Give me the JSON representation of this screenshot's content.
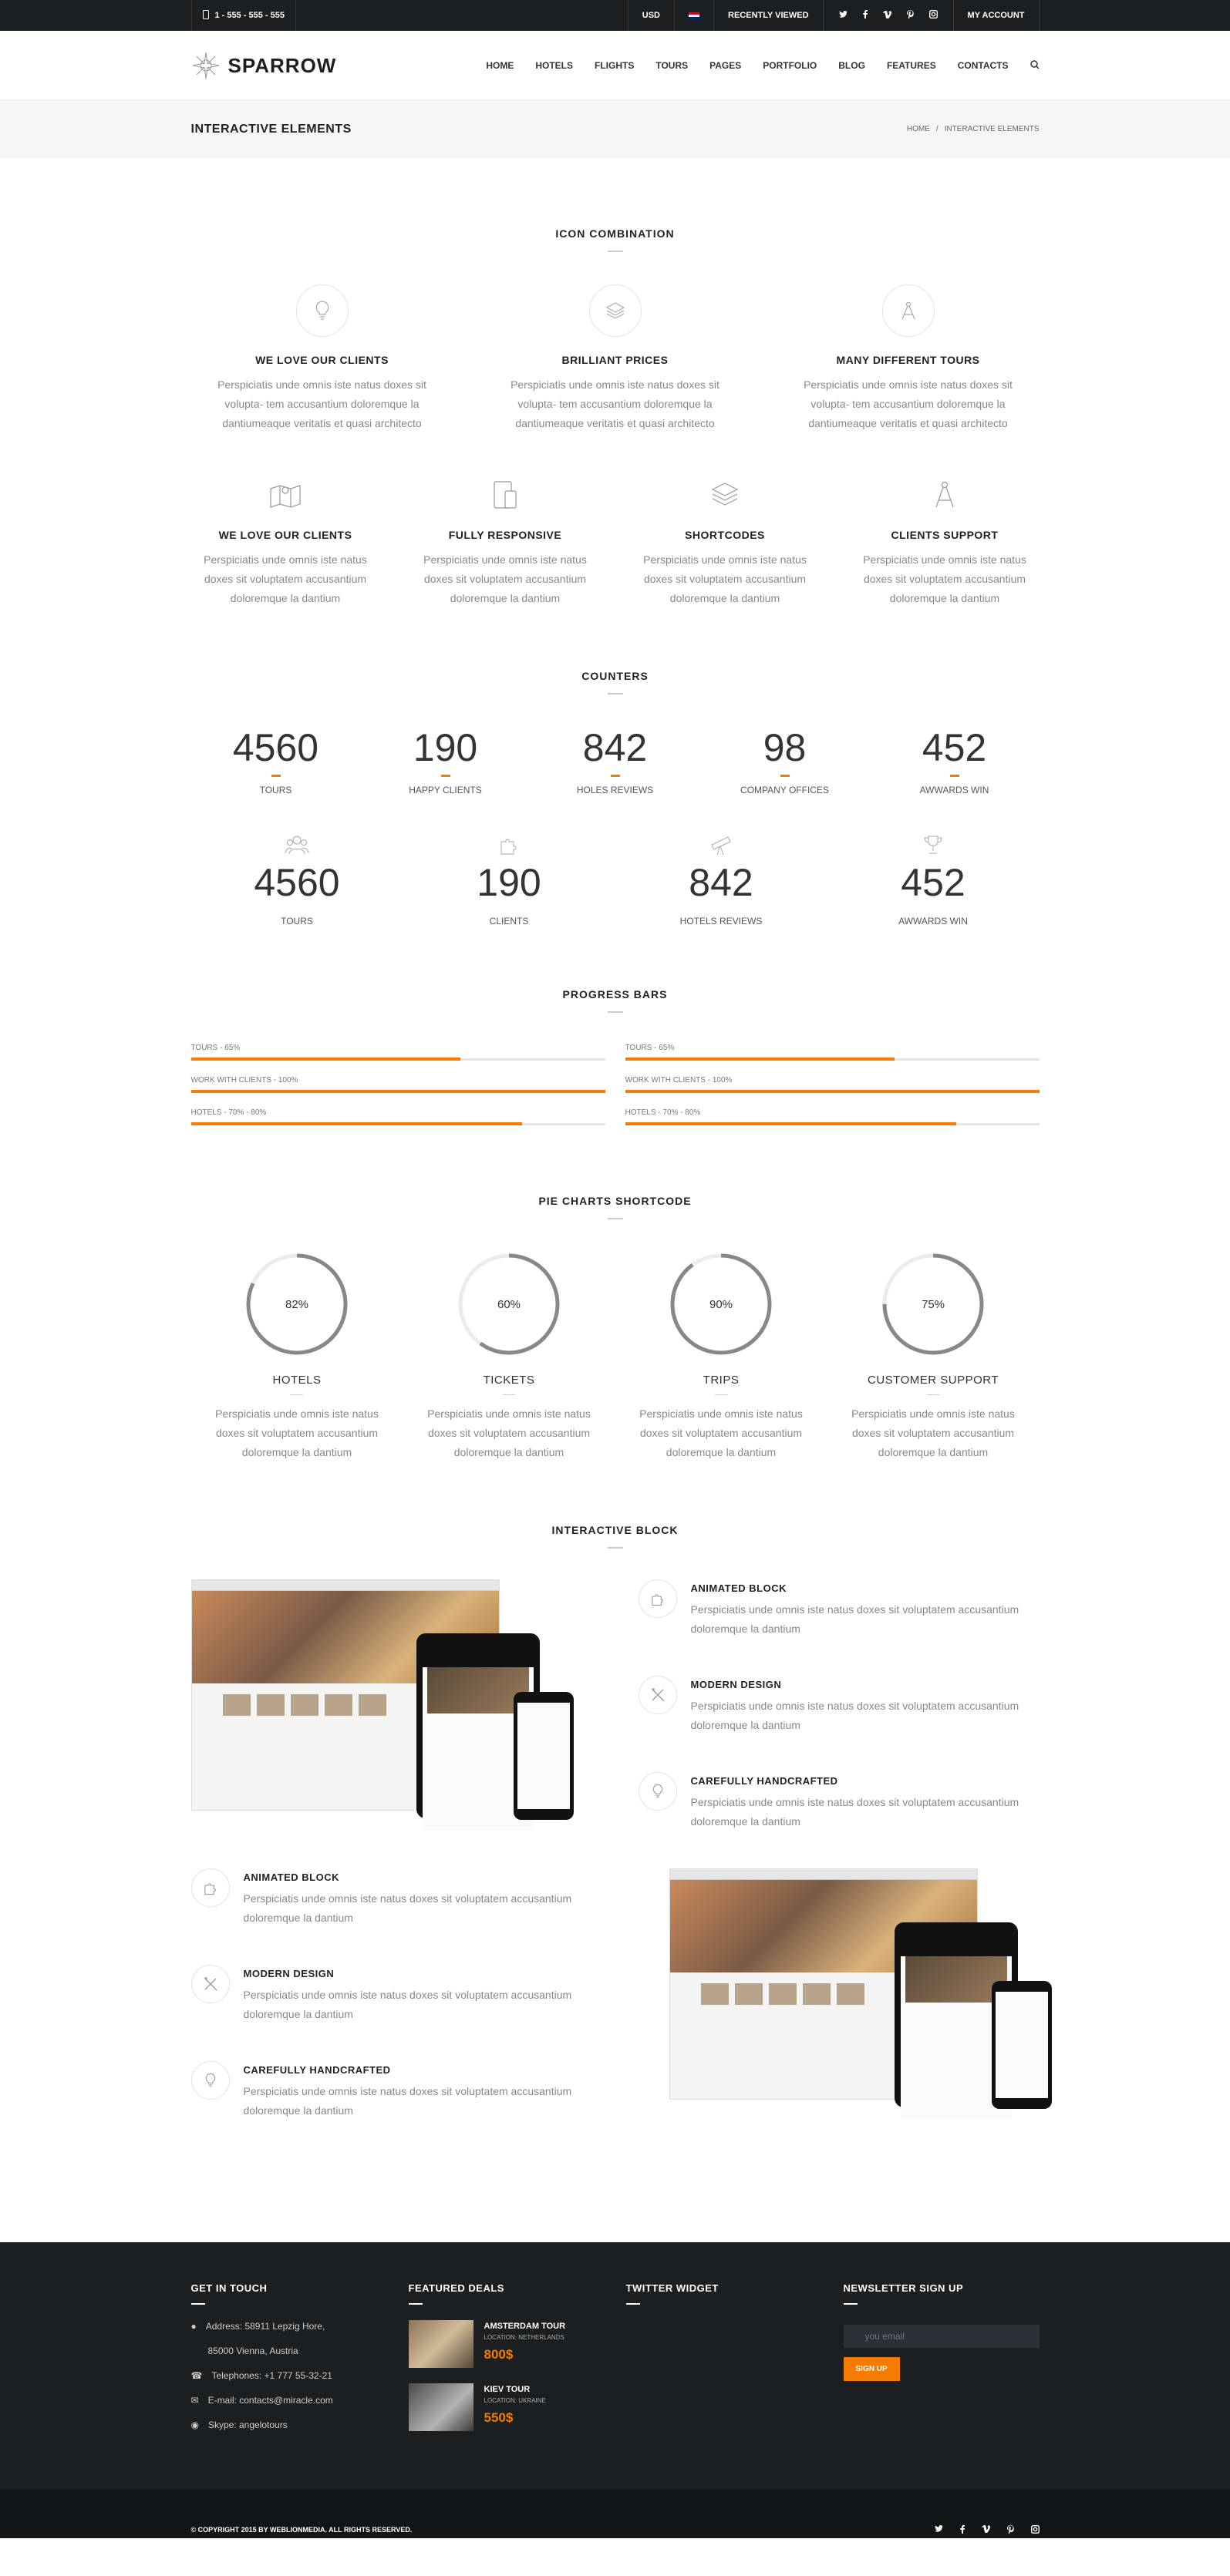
{
  "topbar": {
    "phone": "1 - 555 - 555 - 555",
    "currency": "USD",
    "recently_viewed": "RECENTLY VIEWED",
    "my_account": "MY ACCOUNT",
    "socials": [
      "twitter-icon",
      "facebook-icon",
      "vimeo-icon",
      "pinterest-icon",
      "instagram-icon"
    ]
  },
  "header": {
    "logo": "SPARROW",
    "nav": [
      "HOME",
      "HOTELS",
      "FLIGHTS",
      "TOURS",
      "PAGES",
      "PORTFOLIO",
      "BLOG",
      "FEATURES",
      "CONTACTS"
    ]
  },
  "page_title": {
    "title": "INTERACTIVE ELEMENTS",
    "crumb_home": "HOME",
    "crumb_sep": "/",
    "crumb_current": "INTERACTIVE ELEMENTS"
  },
  "icon_combination": {
    "title": "ICON COMBINATION",
    "row1": [
      {
        "icon": "lightbulb-icon",
        "title": "WE LOVE OUR CLIENTS",
        "text": "Perspiciatis unde omnis iste natus doxes sit volupta- tem accusantium doloremque la dantiumeaque veritatis et quasi architecto"
      },
      {
        "icon": "layers-icon",
        "title": "BRILLIANT PRICES",
        "text": "Perspiciatis unde omnis iste natus doxes sit volupta- tem accusantium doloremque la dantiumeaque veritatis et quasi architecto"
      },
      {
        "icon": "compass-icon",
        "title": "MANY DIFFERENT TOURS",
        "text": "Perspiciatis unde omnis iste natus doxes sit volupta- tem accusantium doloremque la dantiumeaque veritatis et quasi architecto"
      }
    ],
    "row2": [
      {
        "icon": "map-icon",
        "title": "WE LOVE OUR CLIENTS",
        "text": "Perspiciatis unde omnis iste natus doxes sit voluptatem accusantium doloremque la dantium"
      },
      {
        "icon": "devices-icon",
        "title": "FULLY RESPONSIVE",
        "text": "Perspiciatis unde omnis iste natus doxes sit voluptatem accusantium doloremque la dantium"
      },
      {
        "icon": "layers-icon",
        "title": "SHORTCODES",
        "text": "Perspiciatis unde omnis iste natus doxes sit voluptatem accusantium doloremque la dantium"
      },
      {
        "icon": "compass-icon",
        "title": "CLIENTS SUPPORT",
        "text": "Perspiciatis unde omnis iste natus doxes sit voluptatem accusantium doloremque la dantium"
      }
    ]
  },
  "counters": {
    "title": "COUNTERS",
    "row1": [
      {
        "value": "4560",
        "label": "TOURS"
      },
      {
        "value": "190",
        "label": "HAPPY CLIENTS"
      },
      {
        "value": "842",
        "label": "HOLES REVIEWS"
      },
      {
        "value": "98",
        "label": "COMPANY OFFICES"
      },
      {
        "value": "452",
        "label": "AWWARDS WIN"
      }
    ],
    "row2": [
      {
        "icon": "people-icon",
        "value": "4560",
        "label": "TOURS"
      },
      {
        "icon": "puzzle-icon",
        "value": "190",
        "label": "CLIENTS"
      },
      {
        "icon": "telescope-icon",
        "value": "842",
        "label": "HOTELS REVIEWS"
      },
      {
        "icon": "trophy-icon",
        "value": "452",
        "label": "AWWARDS WIN"
      }
    ]
  },
  "progress": {
    "title": "PROGRESS BARS",
    "left": [
      {
        "label": "TOURS - 65%",
        "value": 0.65
      },
      {
        "label": "WORK WITH CLIENTS - 100%",
        "value": 1.0
      },
      {
        "label": "HOTELS - 70% - 80%",
        "value": 0.8
      }
    ],
    "right": [
      {
        "label": "TOURS - 65%",
        "value": 0.65
      },
      {
        "label": "WORK WITH CLIENTS - 100%",
        "value": 1.0
      },
      {
        "label": "HOTELS - 70% - 80%",
        "value": 0.8
      }
    ],
    "accent": "#f57c00"
  },
  "pies": {
    "title": "PIE CHARTS SHORTCODE",
    "items": [
      {
        "pct": "82%",
        "value": 0.82,
        "title": "HOTELS",
        "text": "Perspiciatis unde omnis iste natus doxes sit voluptatem accusantium doloremque la dantium"
      },
      {
        "pct": "60%",
        "value": 0.6,
        "title": "TICKETS",
        "text": "Perspiciatis unde omnis iste natus doxes sit voluptatem accusantium doloremque la dantium"
      },
      {
        "pct": "90%",
        "value": 0.9,
        "title": "TRIPS",
        "text": "Perspiciatis unde omnis iste natus doxes sit voluptatem accusantium doloremque la dantium"
      },
      {
        "pct": "75%",
        "value": 0.75,
        "title": "CUSTOMER SUPPORT",
        "text": "Perspiciatis unde omnis iste natus doxes sit voluptatem accusantium doloremque la dantium"
      }
    ]
  },
  "interactive": {
    "title": "INTERACTIVE BLOCK",
    "items": [
      {
        "icon": "puzzle-icon",
        "title": "ANIMATED BLOCK",
        "text": "Perspiciatis unde omnis iste natus doxes sit voluptatem accusantium doloremque la dantium"
      },
      {
        "icon": "tools-icon",
        "title": "MODERN DESIGN",
        "text": "Perspiciatis unde omnis iste natus doxes sit voluptatem accusantium doloremque la dantium"
      },
      {
        "icon": "lightbulb-icon",
        "title": "CAREFULLY HANDCRAFTED",
        "text": "Perspiciatis unde omnis iste natus doxes sit voluptatem accusantium doloremque la dantium"
      }
    ]
  },
  "footer": {
    "contact_title": "GET IN TOUCH",
    "address1": "Address: 58911 Lepzig Hore,",
    "address2": "85000 Vienna, Austria",
    "phone": "Telephones: +1 777 55-32-21",
    "email": "E-mail: contacts@miracle.com",
    "skype": "Skype: angelotours",
    "deals_title": "FEATURED DEALS",
    "deals": [
      {
        "name": "AMSTERDAM TOUR",
        "location": "LOCATION: NETHERLANDS",
        "price": "800$"
      },
      {
        "name": "KIEV TOUR",
        "location": "LOCATION: UKRAINE",
        "price": "550$"
      }
    ],
    "twitter_title": "TWITTER WIDGET",
    "newsletter_title": "NEWSLETTER SIGN UP",
    "email_placeholder": "you email",
    "signup": "SIGN UP",
    "copyright": "© COPYRIGHT 2015 BY WEBLIONMEDIA. ALL RIGHTS RESERVED."
  }
}
